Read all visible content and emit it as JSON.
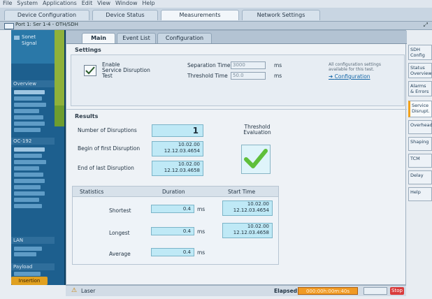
{
  "menubar": {
    "items": [
      "File",
      "System",
      "Applications",
      "Edit",
      "View",
      "Window",
      "Help"
    ]
  },
  "top_tabs": [
    "Device Configuration",
    "Device Status",
    "Measurements",
    "Network Settings"
  ],
  "window": {
    "title": "Port 1: Ser 1-4 - OTH/SDH"
  },
  "sidebar": {
    "top_items": [
      "Sonet",
      "Signal"
    ],
    "sections": [
      {
        "label": "Overview",
        "items": [
          "STS-1",
          "Overhead",
          "LOF/OOF",
          "LOS/AIS",
          "Alarm"
        ]
      },
      {
        "label": "OC-192",
        "items": [
          "Errors",
          "Defects",
          "Alarms",
          "Summary"
        ]
      },
      {
        "label": "LAN",
        "items": [
          "Overview",
          "Events"
        ]
      },
      {
        "label": "Payload",
        "items": [
          "Path Level",
          "Events"
        ]
      }
    ],
    "start_label": "Insertion"
  },
  "main_tabs": [
    "Main",
    "Event List",
    "Configuration"
  ],
  "settings": {
    "title": "Settings",
    "checkbox_label": "Enable\nService Disruption\nTest",
    "separation_time_label": "Separation Time",
    "separation_time_placeholder": "3000",
    "separation_unit": "ms",
    "threshold_label": "Threshold Time",
    "threshold_placeholder": "50.0",
    "threshold_unit": "ms",
    "hint_text": "All configuration settings available for this test.",
    "config_link": "Configuration"
  },
  "results": {
    "title": "Results",
    "num_disruptions_label": "Number of Disruptions",
    "num_disruptions_value": "1",
    "begin_first_label": "Begin of first Disruption",
    "begin_first_value": "10.02.00\n12.12.03.4654",
    "end_last_label": "End of last Disruption",
    "end_last_value": "10.02.00\n12.12.03.4658",
    "threshold_eval_label": "Threshold\nEvaluation"
  },
  "table": {
    "header": {
      "statistics": "Statistics",
      "duration": "Duration",
      "start_time": "Start Time"
    },
    "rows": [
      {
        "label": "Shortest",
        "duration": "0.4",
        "unit": "ms",
        "start_time": "10.02.00\n12.12.03.4654"
      },
      {
        "label": "Longest",
        "duration": "0.4",
        "unit": "ms",
        "start_time": "10.02.00\n12.12.03.4658"
      },
      {
        "label": "Average",
        "duration": "0.4",
        "unit": "ms",
        "start_time": ""
      }
    ]
  },
  "right_rail": [
    "SDH Config",
    "Status Overview",
    "Alarms & Errors",
    "Service Disrupt.",
    "Overhead",
    "Shaping",
    "TCM",
    "Delay",
    "Help"
  ],
  "status": {
    "left_label": "Laser",
    "elapsed_label": "Elapsed:",
    "elapsed_value": "000:00h:00m:40s",
    "state": "Stop"
  },
  "colors": {
    "accent_orange": "#f09a24",
    "sidebar_blue": "#1d5f8e",
    "status_green": "#5fbf3a",
    "teal_field": "#bfe9f6"
  },
  "icons": {
    "checkbox": "checkmark-icon",
    "evaluation": "checkmark-icon",
    "config_link": "arrow-icon",
    "laser": "warning-icon",
    "stop": "stop-icon"
  }
}
